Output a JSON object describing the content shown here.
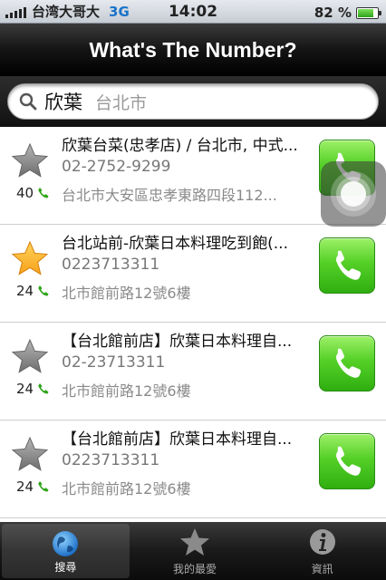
{
  "status_bar": {
    "carrier": "台湾大哥大",
    "network": "3G",
    "time": "14:02",
    "battery": "82 %",
    "battery_level": 0.82
  },
  "navbar": {
    "title": "What's The Number?"
  },
  "search": {
    "value": "欣葉",
    "placeholder": "台北市"
  },
  "results": [
    {
      "title": "欣葉台菜(忠孝店) / 台北市, 中式...",
      "phone": "02-2752-9299",
      "address": "台北市大安區忠孝東路四段112...",
      "count": "40",
      "favorite": false
    },
    {
      "title": " 台北站前-欣葉日本料理吃到飽(...",
      "phone": "0223713311",
      "address": "北市館前路12號6樓",
      "count": "24",
      "favorite": true
    },
    {
      "title": "【台北館前店】欣葉日本料理自...",
      "phone": "02-23713311",
      "address": "北市館前路12號6樓",
      "count": "24",
      "favorite": false
    },
    {
      "title": "【台北館前店】欣葉日本料理自...",
      "phone": "0223713311",
      "address": "北市館前路12號6樓",
      "count": "24",
      "favorite": false
    }
  ],
  "tabs": [
    {
      "label": "搜尋",
      "icon": "globe-icon",
      "active": true
    },
    {
      "label": "我的最愛",
      "icon": "star-icon",
      "active": false
    },
    {
      "label": "資訊",
      "icon": "info-icon",
      "active": false
    }
  ],
  "colors": {
    "call_button": "#4cc823",
    "favorite_star": "#f7a21b",
    "default_star": "#8a8a8a",
    "network_text": "#1a73c9"
  }
}
